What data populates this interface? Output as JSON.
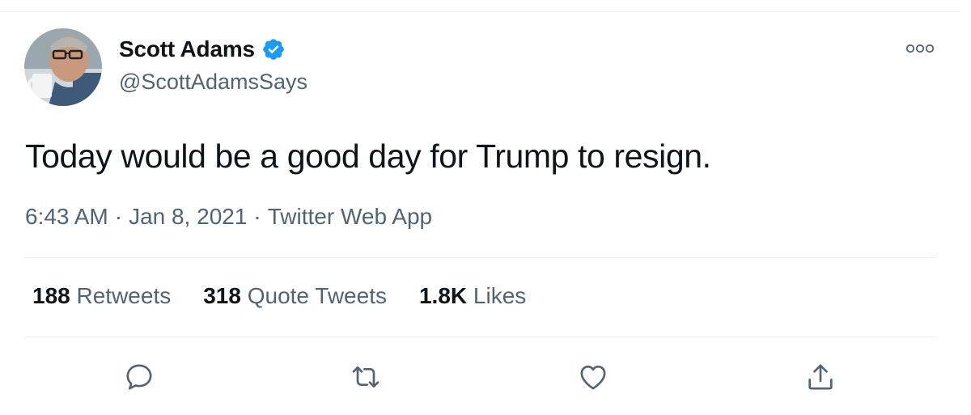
{
  "user": {
    "display_name": "Scott Adams",
    "handle": "@ScottAdamsSays",
    "verified": true
  },
  "tweet": {
    "text": "Today would be a good day for Trump to resign.",
    "time": "6:43 AM",
    "date": "Jan 8, 2021",
    "source": "Twitter Web App",
    "separator": "·"
  },
  "stats": [
    {
      "count": "188",
      "label": "Retweets"
    },
    {
      "count": "318",
      "label": "Quote Tweets"
    },
    {
      "count": "1.8K",
      "label": "Likes"
    }
  ],
  "icons": {
    "more": "more-horizontal-icon",
    "reply": "reply-icon",
    "retweet": "retweet-icon",
    "like": "like-heart-icon",
    "share": "share-icon",
    "verified": "verified-badge-icon"
  },
  "colors": {
    "text_primary": "#0f1419",
    "text_secondary": "#536471",
    "verified_blue": "#1d9bf0",
    "divider": "#e6ecf0"
  }
}
